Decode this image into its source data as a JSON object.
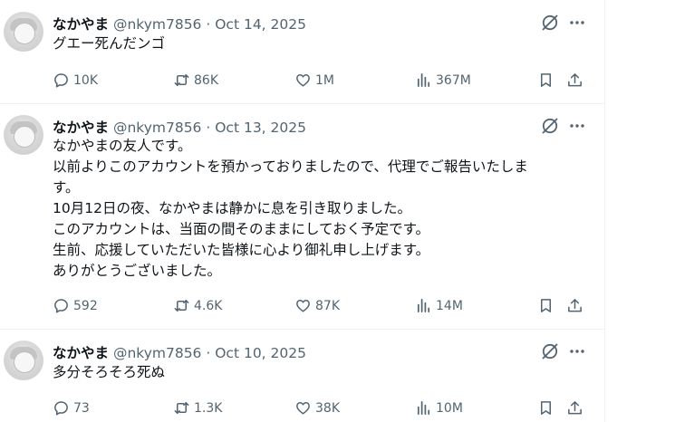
{
  "tweets": [
    {
      "name": "なかやま",
      "handle": "@nkym7856",
      "sep": "·",
      "date": "Oct 14, 2025",
      "lines": [
        "グエー死んだンゴ"
      ],
      "replies": "10K",
      "reposts": "86K",
      "likes": "1M",
      "views": "367M"
    },
    {
      "name": "なかやま",
      "handle": "@nkym7856",
      "sep": "·",
      "date": "Oct 13, 2025",
      "lines": [
        "なかやまの友人です。",
        "以前よりこのアカウントを預かっておりましたので、代理でご報告いたしま",
        "す。",
        "10月12日の夜、なかやまは静かに息を引き取りました。",
        "このアカウントは、当面の間そのままにしておく予定です。",
        "生前、応援していただいた皆様に心より御礼申し上げます。",
        "ありがとうございました。"
      ],
      "replies": "592",
      "reposts": "4.6K",
      "likes": "87K",
      "views": "14M"
    },
    {
      "name": "なかやま",
      "handle": "@nkym7856",
      "sep": "·",
      "date": "Oct 10, 2025",
      "lines": [
        "多分そろそろ死ぬ"
      ],
      "replies": "73",
      "reposts": "1.3K",
      "likes": "38K",
      "views": "10M"
    }
  ],
  "icons": [
    "grok-icon",
    "more-icon",
    "reply-icon",
    "repost-icon",
    "like-icon",
    "views-icon",
    "bookmark-icon",
    "share-icon"
  ],
  "colors": {
    "text": "#0f1419",
    "secondary": "#536471",
    "divider": "#eff3f4"
  }
}
